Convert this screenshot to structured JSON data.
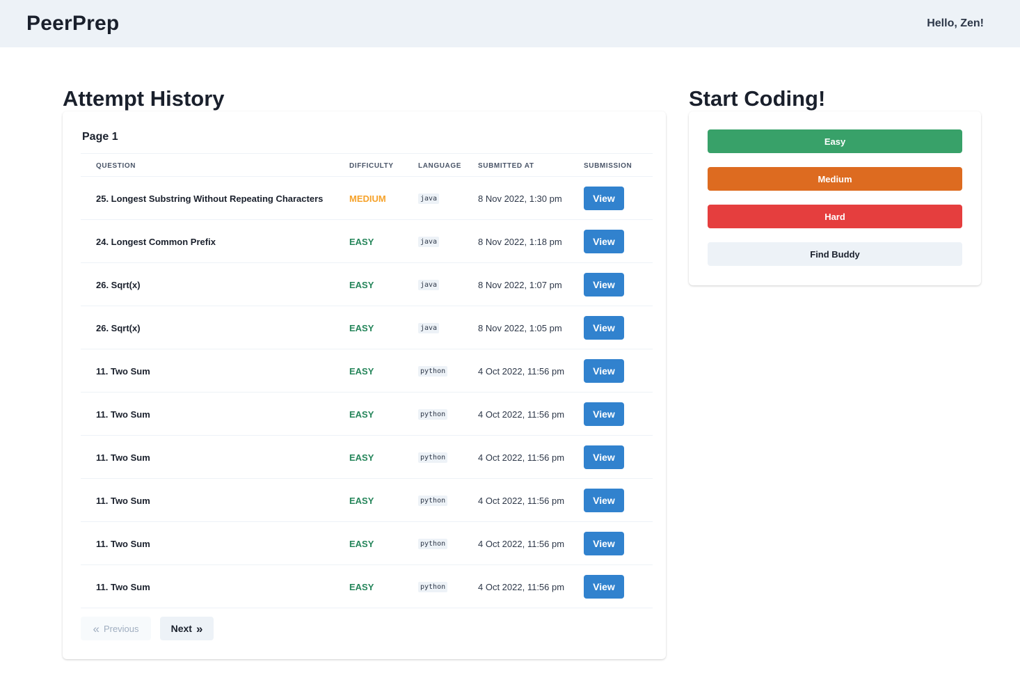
{
  "header": {
    "brand": "PeerPrep",
    "greeting": "Hello, Zen!"
  },
  "history": {
    "title": "Attempt History",
    "page_label": "Page 1",
    "columns": {
      "question": "Question",
      "difficulty": "Difficulty",
      "language": "Language",
      "submitted_at": "Submitted At",
      "submission": "Submission"
    },
    "rows": [
      {
        "question": "25. Longest Substring Without Repeating Characters",
        "difficulty": "MEDIUM",
        "language": "java",
        "submitted_at": "8 Nov 2022, 1:30 pm",
        "action": "View"
      },
      {
        "question": "24. Longest Common Prefix",
        "difficulty": "EASY",
        "language": "java",
        "submitted_at": "8 Nov 2022, 1:18 pm",
        "action": "View"
      },
      {
        "question": "26. Sqrt(x)",
        "difficulty": "EASY",
        "language": "java",
        "submitted_at": "8 Nov 2022, 1:07 pm",
        "action": "View"
      },
      {
        "question": "26. Sqrt(x)",
        "difficulty": "EASY",
        "language": "java",
        "submitted_at": "8 Nov 2022, 1:05 pm",
        "action": "View"
      },
      {
        "question": "11. Two Sum",
        "difficulty": "EASY",
        "language": "python",
        "submitted_at": "4 Oct 2022, 11:56 pm",
        "action": "View"
      },
      {
        "question": "11. Two Sum",
        "difficulty": "EASY",
        "language": "python",
        "submitted_at": "4 Oct 2022, 11:56 pm",
        "action": "View"
      },
      {
        "question": "11. Two Sum",
        "difficulty": "EASY",
        "language": "python",
        "submitted_at": "4 Oct 2022, 11:56 pm",
        "action": "View"
      },
      {
        "question": "11. Two Sum",
        "difficulty": "EASY",
        "language": "python",
        "submitted_at": "4 Oct 2022, 11:56 pm",
        "action": "View"
      },
      {
        "question": "11. Two Sum",
        "difficulty": "EASY",
        "language": "python",
        "submitted_at": "4 Oct 2022, 11:56 pm",
        "action": "View"
      },
      {
        "question": "11. Two Sum",
        "difficulty": "EASY",
        "language": "python",
        "submitted_at": "4 Oct 2022, 11:56 pm",
        "action": "View"
      }
    ],
    "pagination": {
      "previous": "Previous",
      "next": "Next",
      "previous_icon": "double-chevron-left-icon",
      "next_icon": "double-chevron-right-icon"
    }
  },
  "coding": {
    "title": "Start Coding!",
    "buttons": {
      "easy": "Easy",
      "medium": "Medium",
      "hard": "Hard",
      "buddy": "Find Buddy"
    }
  },
  "colors": {
    "easy": "#38a169",
    "medium": "#dd6b20",
    "hard": "#e53e3e",
    "easy_text": "#25855a",
    "medium_text": "#f6a22a",
    "view_button": "#3182ce"
  }
}
